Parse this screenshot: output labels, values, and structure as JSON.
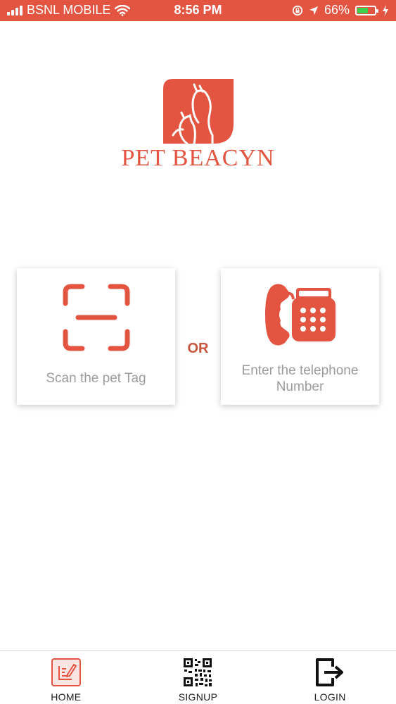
{
  "status_bar": {
    "carrier": "BSNL MOBILE",
    "time": "8:56 PM",
    "battery_percent": "66%",
    "battery_level": 0.66,
    "bar_color": "#e35541",
    "battery_color": "#3fd24f"
  },
  "brand": {
    "name": "PET BEACYN",
    "color": "#e35541"
  },
  "options": {
    "scan": {
      "label": "Scan the pet Tag",
      "icon": "scan-frame-icon"
    },
    "separator": "OR",
    "phone": {
      "label": "Enter the telephone Number",
      "icon": "telephone-icon"
    }
  },
  "bottom_nav": {
    "items": [
      {
        "label": "HOME",
        "icon": "edit-document-icon"
      },
      {
        "label": "SIGNUP",
        "icon": "qr-code-icon"
      },
      {
        "label": "LOGIN",
        "icon": "logout-icon"
      }
    ]
  }
}
